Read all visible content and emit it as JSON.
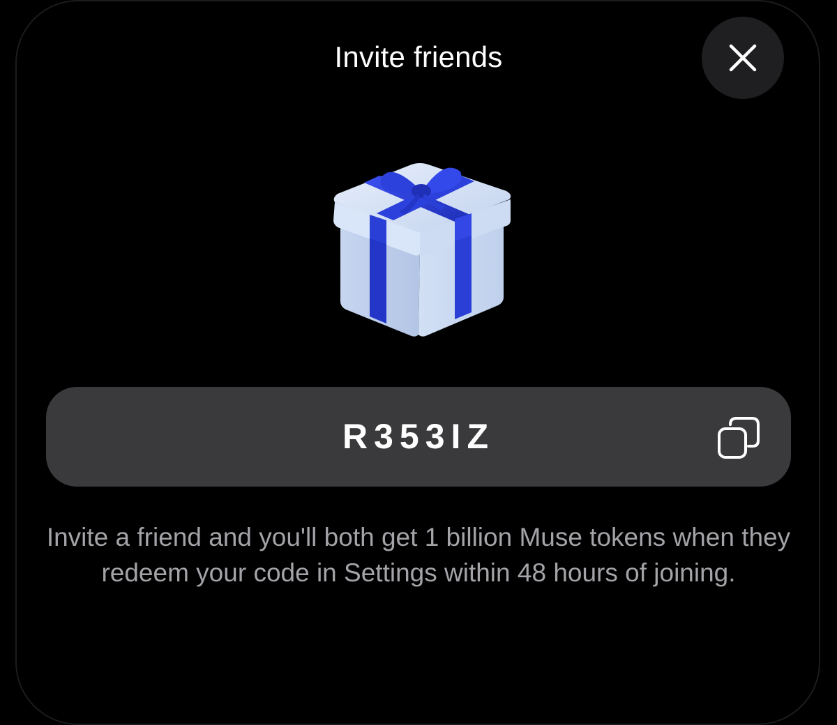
{
  "header": {
    "title": "Invite friends",
    "close_icon": "close-icon"
  },
  "gift": {
    "icon": "gift-box-icon",
    "box_color": "#c9d9f2",
    "ribbon_color": "#2a3fd6"
  },
  "invite": {
    "code": "R353IZ",
    "copy_icon": "copy-icon"
  },
  "description": "Invite a friend and you'll both get 1 billion Muse tokens when they redeem your code in Settings within 48 hours of joining.",
  "colors": {
    "background": "#000000",
    "code_bar": "#3a3a3c",
    "close_button": "#1f1f21",
    "secondary_text": "#a3a3a8"
  }
}
